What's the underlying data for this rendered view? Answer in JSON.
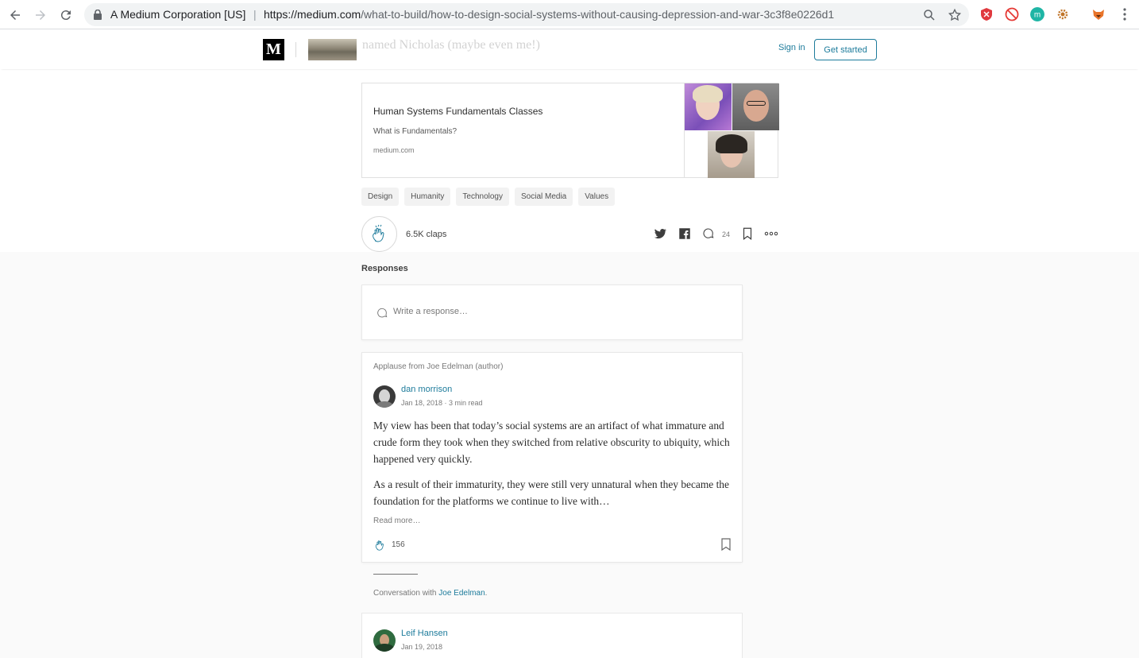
{
  "browser": {
    "site_identity": "A Medium Corporation [US]",
    "url_host": "https://medium.com",
    "url_path": "/what-to-build/how-to-design-social-systems-without-causing-depression-and-war-3c3f8e0226d1",
    "icons": [
      "back-icon",
      "forward-icon",
      "reload-icon",
      "lock-icon",
      "zoom-icon",
      "star-icon",
      "shield-extension-icon",
      "block-extension-icon",
      "m-extension-icon",
      "gear-extension-icon",
      "fox-extension-icon",
      "menu-icon"
    ]
  },
  "header": {
    "logo": "M",
    "faded_text": "named Nicholas (maybe even me!)",
    "signin": "Sign in",
    "get_started": "Get started"
  },
  "embed": {
    "title": "Human Systems Fundamentals Classes",
    "subtitle": "What is Fundamentals?",
    "domain": "medium.com"
  },
  "tags": [
    "Design",
    "Humanity",
    "Technology",
    "Social Media",
    "Values"
  ],
  "actions": {
    "claps": "6.5K claps",
    "responses_count": "24"
  },
  "responses": {
    "label": "Responses",
    "write_placeholder": "Write a response…",
    "card1": {
      "applause": "Applause from Joe Edelman (author)",
      "author": "dan morrison",
      "meta": "Jan 18, 2018 · 3 min read",
      "para1": "My view has been that today’s social systems are an artifact of what immature and crude form they took when they switched from relative obscurity to ubiquity, which happened very quickly.",
      "para2": "As a result of their immaturity, they were still very unnatural when they became the foundation for the platforms we continue to live with…",
      "read_more": "Read more…",
      "claps": "156"
    },
    "conversation_prefix": "Conversation with ",
    "conversation_name": "Joe Edelman",
    "conversation_suffix": ".",
    "card2": {
      "author": "Leif Hansen",
      "meta": "Jan 19, 2018"
    }
  },
  "colors": {
    "accent": "#1d7b9b",
    "background_gray": "#fafafa"
  }
}
